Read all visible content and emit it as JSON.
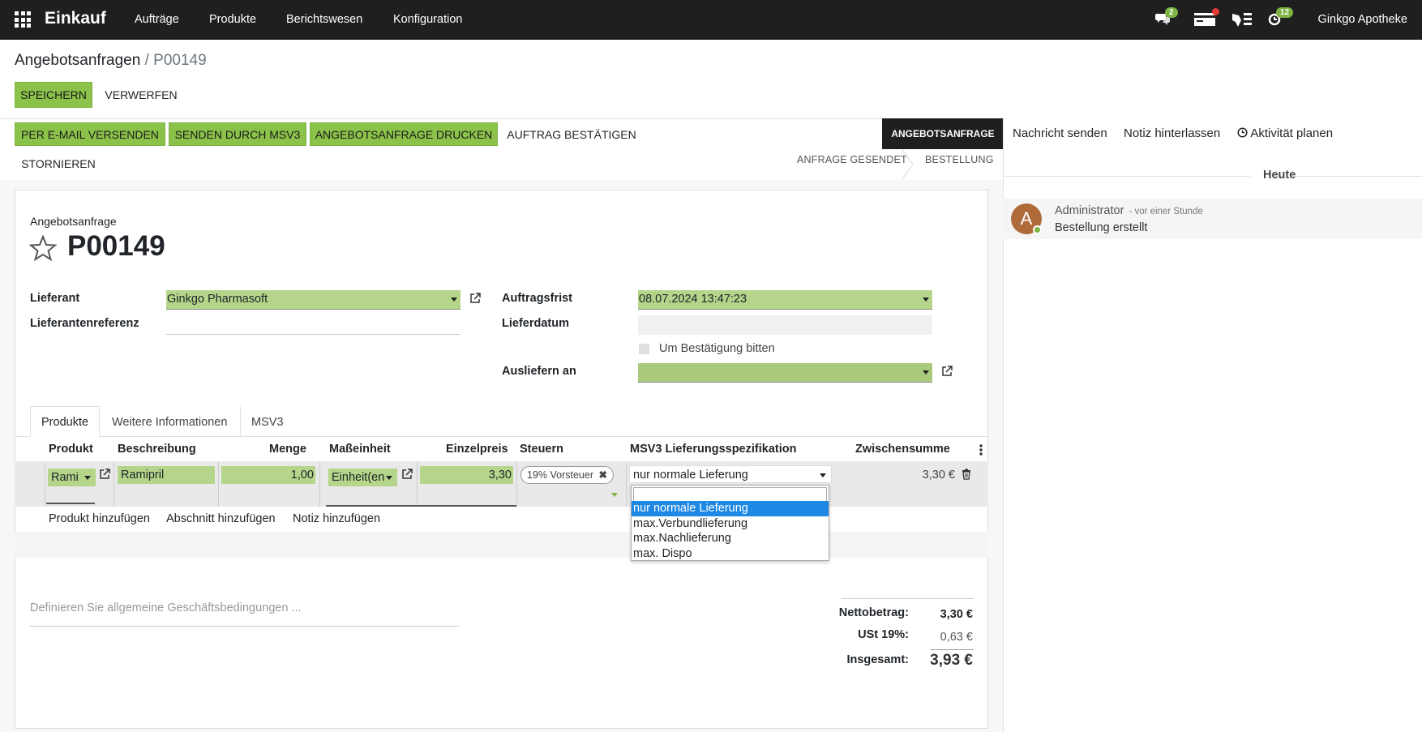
{
  "navbar": {
    "brand": "Einkauf",
    "menu": [
      "Aufträge",
      "Produkte",
      "Berichtswesen",
      "Konfiguration"
    ],
    "messages_badge": "2",
    "activities_badge": "12",
    "company": "Ginkgo Apotheke"
  },
  "breadcrumb": {
    "parent": "Angebotsanfragen",
    "separator": "/",
    "current": "P00149"
  },
  "actions": {
    "save": "SPEICHERN",
    "discard": "VERWERFEN"
  },
  "header_buttons": {
    "email": "PER E-MAIL VERSENDEN",
    "msv3": "SENDEN DURCH MSV3",
    "print": "ANGEBOTSANFRAGE DRUCKEN",
    "confirm": "AUFTRAG BESTÄTIGEN",
    "cancel": "STORNIEREN"
  },
  "statusbar": {
    "active": "ANGEBOTSANFRAGE",
    "sent": "ANFRAGE GESENDET",
    "order": "BESTELLUNG"
  },
  "form": {
    "doc_type": "Angebotsanfrage",
    "name": "P00149",
    "vendor_label": "Lieferant",
    "vendor_value": "Ginkgo Pharmasoft",
    "vendor_ref_label": "Lieferantenreferenz",
    "vendor_ref_value": "",
    "deadline_label": "Auftragsfrist",
    "deadline_value": "08.07.2024 13:47:23",
    "receipt_date_label": "Lieferdatum",
    "receipt_date_value": "",
    "ask_confirmation_label": "Um Bestätigung bitten",
    "deliver_to_label": "Ausliefern an",
    "deliver_to_value": ""
  },
  "tabs": [
    "Produkte",
    "Weitere Informationen",
    "MSV3"
  ],
  "table": {
    "headers": {
      "product": "Produkt",
      "description": "Beschreibung",
      "quantity": "Menge",
      "uom": "Maßeinheit",
      "price": "Einzelpreis",
      "taxes": "Steuern",
      "msv3": "MSV3 Lieferungsspezifikation",
      "subtotal": "Zwischensumme"
    },
    "row": {
      "product": "Rami",
      "description": "Ramipril",
      "quantity": "1,00",
      "uom": "Einheit(en",
      "price": "3,30",
      "tax": "19% Vorsteuer",
      "msv3": "nur normale Lieferung",
      "subtotal": "3,30 €"
    },
    "add_product": "Produkt hinzufügen",
    "add_section": "Abschnitt hinzufügen",
    "add_note": "Notiz hinzufügen"
  },
  "dropdown": {
    "options": [
      "nur normale Lieferung",
      "max.Verbundlieferung",
      "max.Nachlieferung",
      "max. Dispo"
    ],
    "selected_index": 0
  },
  "notes_placeholder": "Definieren Sie allgemeine Geschäftsbedingungen ...",
  "totals": {
    "net_label": "Nettobetrag:",
    "net_value": "3,30 €",
    "tax_label": "USt 19%:",
    "tax_value": "0,63 €",
    "total_label": "Insgesamt:",
    "total_value": "3,93 €"
  },
  "chatter": {
    "send_message": "Nachricht senden",
    "log_note": "Notiz hinterlassen",
    "schedule_activity": "Aktivität planen",
    "date_separator": "Heute",
    "author": "Administrator",
    "time": "- vor einer Stunde",
    "avatar_letter": "A",
    "body": "Bestellung erstellt"
  }
}
